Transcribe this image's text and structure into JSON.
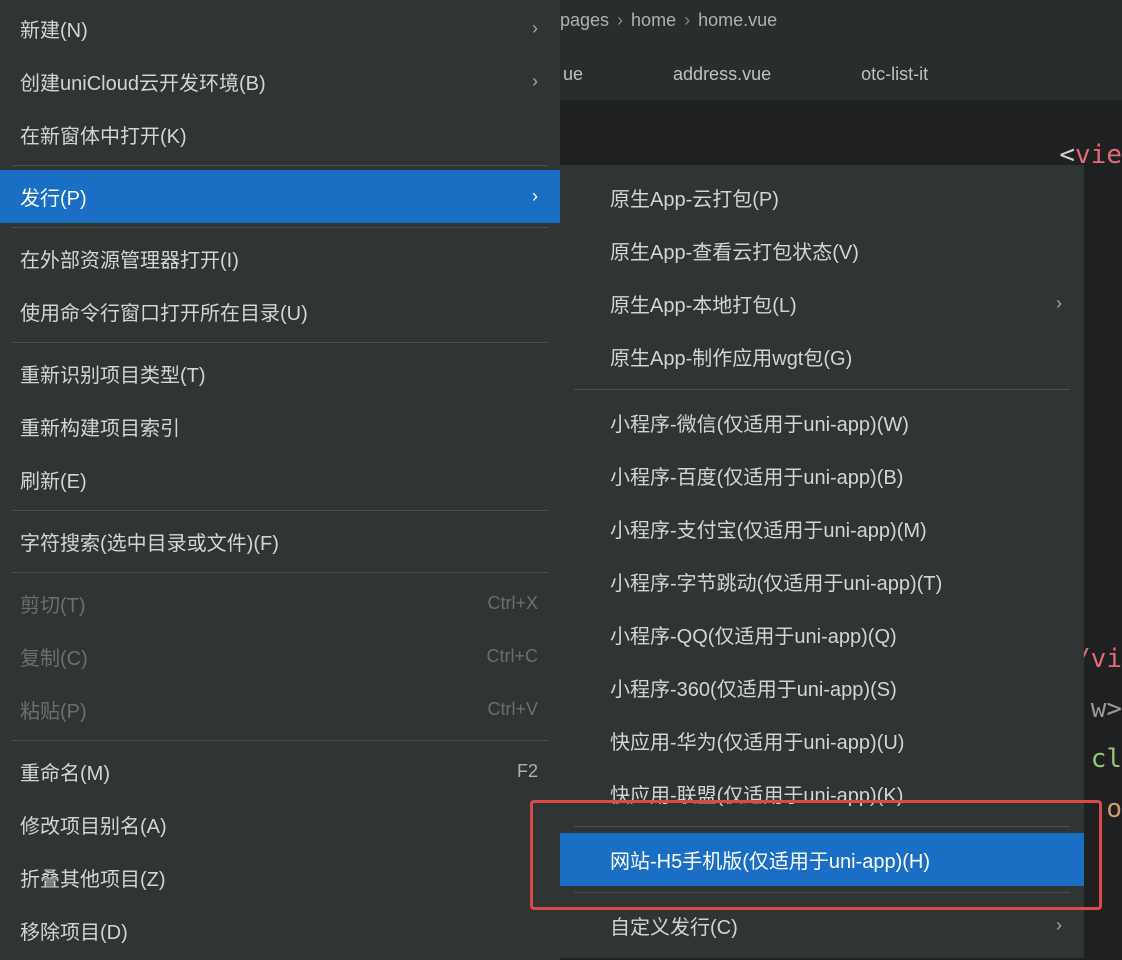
{
  "breadcrumbs": {
    "b1": "pages",
    "b2": "home",
    "b3": "home.vue"
  },
  "tabs": {
    "t1": "ue",
    "t2": "address.vue",
    "t3": "otc-list-it"
  },
  "code": {
    "line1_open": "<",
    "line1_tag": "vie",
    "frag_v": "/vi",
    "frag_w": "w>",
    "frag_cl": "cl",
    "frag_o": "o"
  },
  "menu": {
    "new": "新建(N)",
    "unicloud": "创建uniCloud云开发环境(B)",
    "openwin": "在新窗体中打开(K)",
    "publish": "发行(P)",
    "explorer": "在外部资源管理器打开(I)",
    "cmdline": "使用命令行窗口打开所在目录(U)",
    "reident": "重新识别项目类型(T)",
    "reindex": "重新构建项目索引",
    "refresh": "刷新(E)",
    "search": "字符搜索(选中目录或文件)(F)",
    "cut": "剪切(T)",
    "cut_k": "Ctrl+X",
    "copy": "复制(C)",
    "copy_k": "Ctrl+C",
    "paste": "粘贴(P)",
    "paste_k": "Ctrl+V",
    "rename": "重命名(M)",
    "rename_k": "F2",
    "alias": "修改项目别名(A)",
    "fold": "折叠其他项目(Z)",
    "remove": "移除项目(D)"
  },
  "submenu": {
    "s1": "原生App-云打包(P)",
    "s2": "原生App-查看云打包状态(V)",
    "s3": "原生App-本地打包(L)",
    "s4": "原生App-制作应用wgt包(G)",
    "s5": "小程序-微信(仅适用于uni-app)(W)",
    "s6": "小程序-百度(仅适用于uni-app)(B)",
    "s7": "小程序-支付宝(仅适用于uni-app)(M)",
    "s8": "小程序-字节跳动(仅适用于uni-app)(T)",
    "s9": "小程序-QQ(仅适用于uni-app)(Q)",
    "s10": "小程序-360(仅适用于uni-app)(S)",
    "s11": "快应用-华为(仅适用于uni-app)(U)",
    "s12": "快应用-联盟(仅适用于uni-app)(K)",
    "s13": "网站-H5手机版(仅适用于uni-app)(H)",
    "s14": "自定义发行(C)"
  }
}
